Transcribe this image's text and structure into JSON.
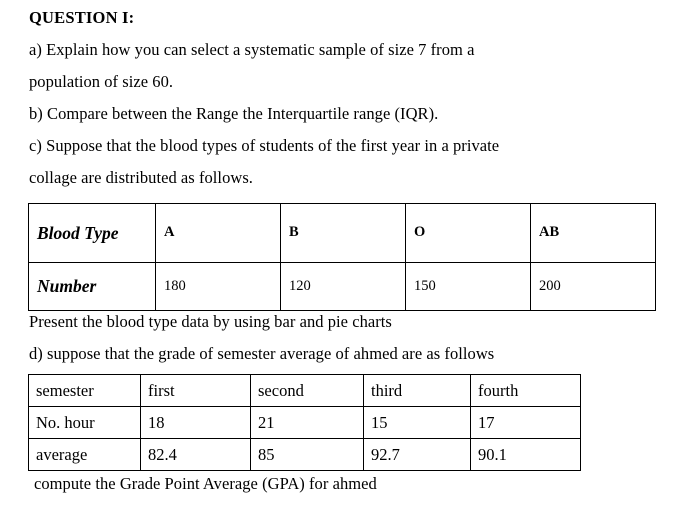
{
  "document": {
    "title": "QUESTION I:",
    "paragraphs": [
      "a) Explain how you can select a systematic sample of size 7 from a",
      "population of size 60.",
      "b) Compare between the Range the Interquartile range (IQR).",
      "c) Suppose that the blood types of students of the first year in a private",
      "collage are  distributed as follows.",
      "Present the blood type data by using bar and pie charts",
      "d) suppose that the grade of semester average of ahmed are as follows",
      "compute the Grade Point Average (GPA) for ahmed"
    ]
  },
  "blood_table": {
    "row_labels": [
      "Blood Type",
      "Number"
    ],
    "types": [
      "A",
      "B",
      "O",
      "AB"
    ],
    "numbers": [
      "180",
      "120",
      "150",
      "200"
    ]
  },
  "semester_table": {
    "row_labels": [
      "semester",
      "No. hour",
      "average"
    ],
    "semesters": [
      "first",
      "second",
      "third",
      "fourth"
    ],
    "hours": [
      "18",
      "21",
      "15",
      "17"
    ],
    "averages": [
      "82.4",
      "85",
      "92.7",
      "90.1"
    ]
  }
}
